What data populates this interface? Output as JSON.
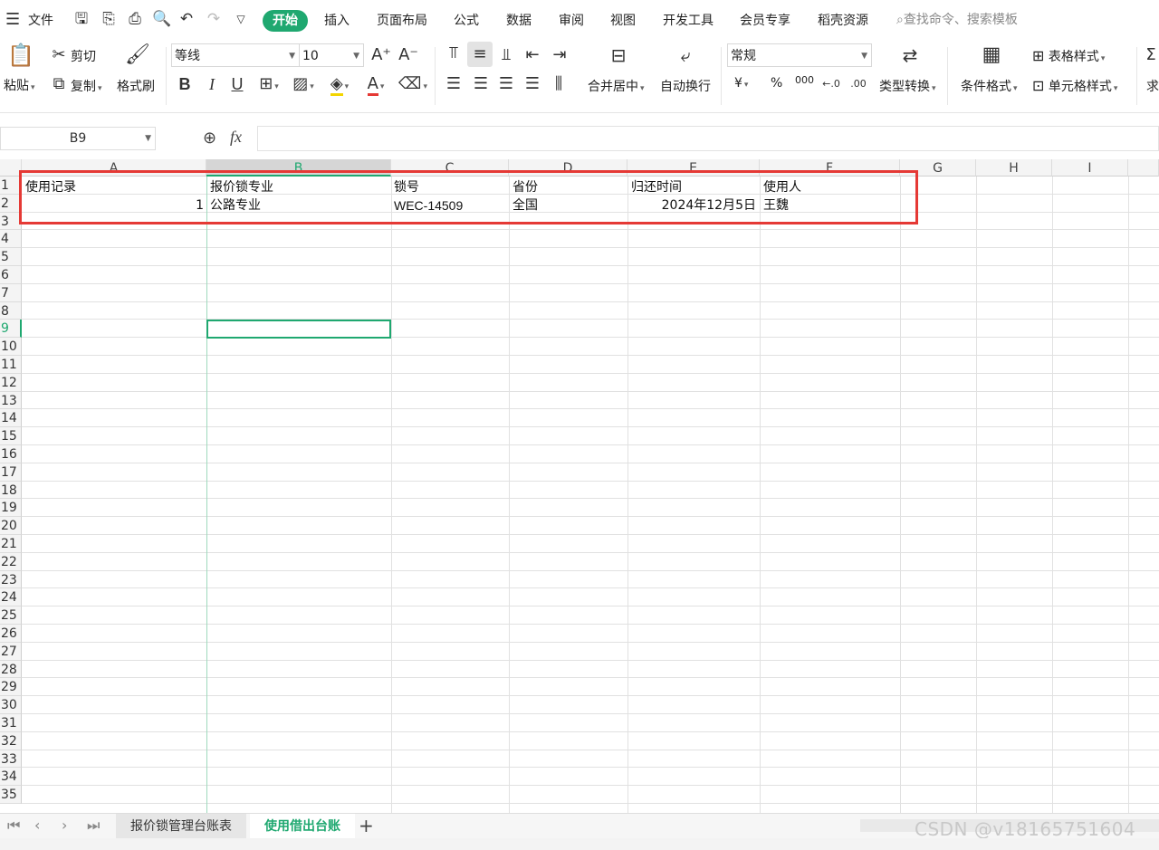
{
  "menu": {
    "file": "文件",
    "tabs": [
      "开始",
      "插入",
      "页面布局",
      "公式",
      "数据",
      "审阅",
      "视图",
      "开发工具",
      "会员专享",
      "稻壳资源"
    ],
    "search_placeholder": "查找命令、搜索模板"
  },
  "ribbon": {
    "paste": "粘贴",
    "cut": "剪切",
    "copy": "复制",
    "format_painter": "格式刷",
    "font_name": "等线",
    "font_size": "10",
    "merge_center": "合并居中",
    "wrap_text": "自动换行",
    "number_format": "常规",
    "type_convert": "类型转换",
    "conditional_format": "条件格式",
    "table_style": "表格样式",
    "cell_style": "单元格样式",
    "currency_symbol": "¥",
    "percent_symbol": "%",
    "thousands_symbol": "000",
    "sum_partial": "求"
  },
  "formula_bar": {
    "name_box": "B9",
    "fx": "fx",
    "content": ""
  },
  "grid": {
    "columns": [
      "A",
      "B",
      "C",
      "D",
      "E",
      "F",
      "G",
      "H",
      "I"
    ],
    "rows": [
      "1",
      "2",
      "3",
      "4",
      "5",
      "6",
      "7",
      "8",
      "9",
      "10",
      "11",
      "12",
      "13",
      "14",
      "15",
      "16",
      "17",
      "18",
      "19",
      "20",
      "21",
      "22",
      "23",
      "24",
      "25",
      "26",
      "27",
      "28",
      "29",
      "30",
      "31",
      "32",
      "33",
      "34",
      "35"
    ],
    "header_row": [
      "使用记录",
      "报价锁专业",
      "锁号",
      "省份",
      "归还时间",
      "使用人"
    ],
    "data_row": [
      "1",
      "公路专业",
      "WEC-14509",
      "全国",
      "2024年12月5日",
      "王魏"
    ],
    "selected_cell": "B9"
  },
  "sheets": {
    "tab1": "报价锁管理台账表",
    "tab2": "使用借出台账"
  },
  "watermark": "CSDN @v18165751604",
  "colors": {
    "accent": "#1fa870",
    "highlight": "#e53935"
  }
}
